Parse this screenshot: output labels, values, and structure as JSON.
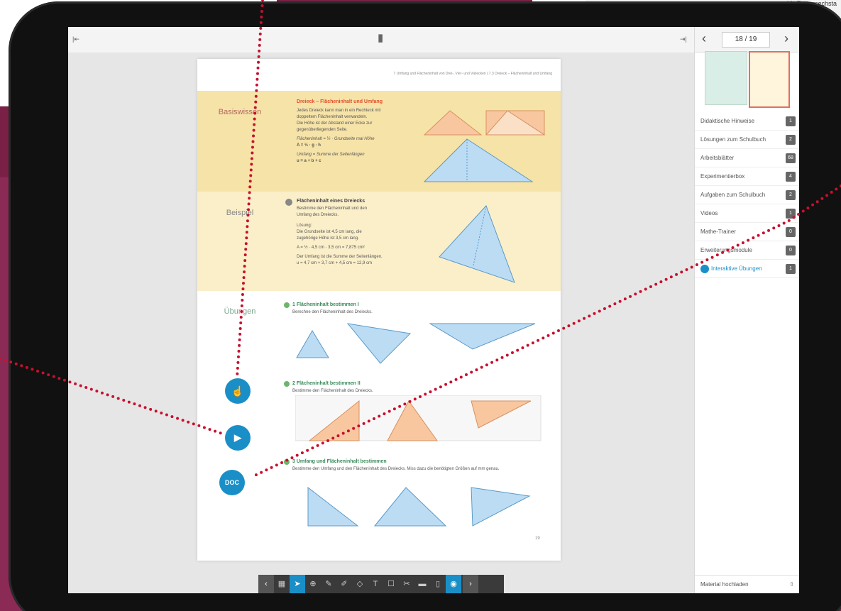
{
  "background": {
    "corner_text": "10. Es versechsta"
  },
  "viewer": {
    "page_indicator": "18 / 19",
    "materials": [
      {
        "label": "Didaktische Hinweise",
        "count": "1"
      },
      {
        "label": "Lösungen zum Schulbuch",
        "count": "2"
      },
      {
        "label": "Arbeitsblätter",
        "count": "68"
      },
      {
        "label": "Experimentierbox",
        "count": "4"
      },
      {
        "label": "Aufgaben zum Schulbuch",
        "count": "2"
      },
      {
        "label": "Videos",
        "count": "1"
      },
      {
        "label": "Mathe-Trainer",
        "count": "0"
      },
      {
        "label": "Erweiterungsmodule",
        "count": "0"
      },
      {
        "label": "Interaktive Übungen",
        "count": "1"
      }
    ],
    "upload_label": "Material hochladen"
  },
  "page": {
    "breadcrumb": "7 Umfang und Flächeninhalt von Drei-, Vier- und Vielecken | 7.3 Dreieck – Flächeninhalt und Umfang",
    "basiswissen": {
      "section": "Basiswissen",
      "title": "Dreieck – Flächeninhalt und Umfang",
      "lines": [
        "Jedes Dreieck kann man in ein Rechteck mit",
        "doppeltem Flächeninhalt verwandeln.",
        "Die Höhe ist der Abstand einer Ecke zur",
        "gegenüberliegenden Seite.",
        "Flächeninhalt = ½ · Grundseite mal Höhe",
        "A = ½ · g · h",
        "Umfang = Summe der Seitenlängen",
        "u = a + b + c"
      ]
    },
    "beispiel": {
      "section": "Beispiel",
      "title": "Flächeninhalt eines Dreiecks",
      "lines": [
        "Bestimme den Flächeninhalt und den",
        "Umfang des Dreiecks.",
        "Lösung:",
        "Die Grundseite ist 4,5 cm lang, die",
        "zugehörige Höhe ist 3,5 cm lang.",
        "A = ½ · 4,5 cm · 3,5 cm = 7,875 cm²",
        "Der Umfang ist die Summe der Seitenlängen.",
        "u = 4,7 cm + 3,7 cm + 4,5 cm = 12,9 cm"
      ]
    },
    "uebungen": {
      "section": "Übungen",
      "ex1_title": "1 Flächeninhalt bestimmen I",
      "ex1_text": "Berechne den Flächeninhalt des Dreiecks.",
      "ex2_title": "2 Flächeninhalt bestimmen II",
      "ex2_text": "Bestimme den Flächeninhalt des Dreiecks.",
      "ex3_title": "3 Umfang und Flächeninhalt bestimmen",
      "ex3_text": "Bestimme den Umfang und den Flächeninhalt des Dreiecks. Miss dazu die benötigten Größen auf mm genau."
    },
    "page_number": "19",
    "doc_label": "DOC"
  }
}
